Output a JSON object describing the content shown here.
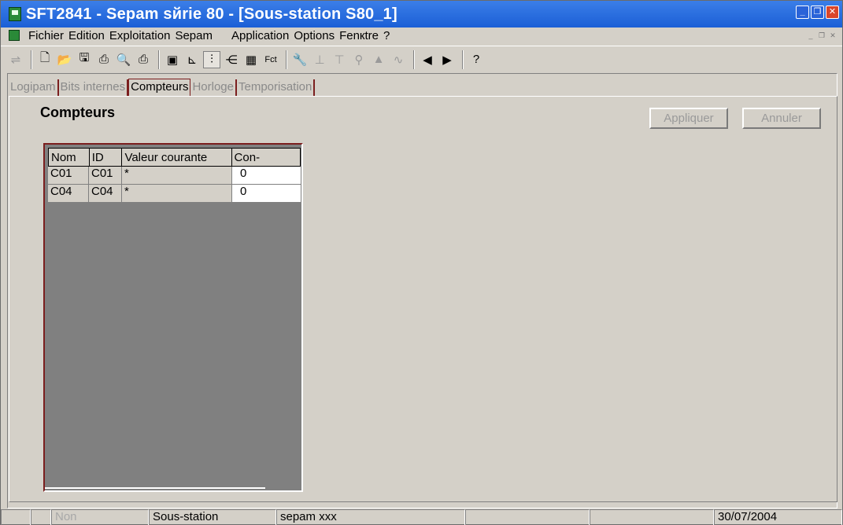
{
  "window": {
    "title": "SFT2841 - Sepam sйrie 80 - [Sous-station S80_1]",
    "buttons": [
      "minimize",
      "restore",
      "close"
    ]
  },
  "menu": {
    "items": [
      "Fichier",
      "Edition",
      "Exploitation",
      "Sepam",
      "Application",
      "Options",
      "Fenкtre",
      "?"
    ]
  },
  "toolbar": {
    "fct_label": "Fct",
    "icons": [
      "disconnect-icon",
      "new-icon",
      "open-icon",
      "save-icon",
      "print-icon",
      "print-preview-icon",
      "print-setup-icon",
      "sepam-icon",
      "diagram-icon",
      "inputs-icon",
      "outputs-icon",
      "matrix-icon",
      "fct-icon",
      "wrench-icon",
      "ct-icon",
      "vt-icon",
      "plug-icon",
      "triangle-icon",
      "wave-icon",
      "prev-icon",
      "next-icon",
      "help-icon"
    ]
  },
  "tabs": [
    {
      "label": "Logipam",
      "active": false
    },
    {
      "label": "Bits internes",
      "active": false
    },
    {
      "label": "Compteurs",
      "active": true
    },
    {
      "label": "Horloge",
      "active": false
    },
    {
      "label": "Temporisation",
      "active": false
    }
  ],
  "page": {
    "heading": "Compteurs",
    "apply_label": "Appliquer",
    "cancel_label": "Annuler"
  },
  "table": {
    "columns": [
      "Nom",
      "ID",
      "Valeur courante",
      "Con-"
    ],
    "rows": [
      {
        "nom": "C01",
        "id": "C01",
        "valeur": "*",
        "con": "0"
      },
      {
        "nom": "C04",
        "id": "C04",
        "valeur": "*",
        "con": "0"
      }
    ]
  },
  "status": {
    "mode": "Non",
    "station_label": "Sous-station",
    "sepam": "sepam xxx",
    "date": "30/07/2004"
  }
}
